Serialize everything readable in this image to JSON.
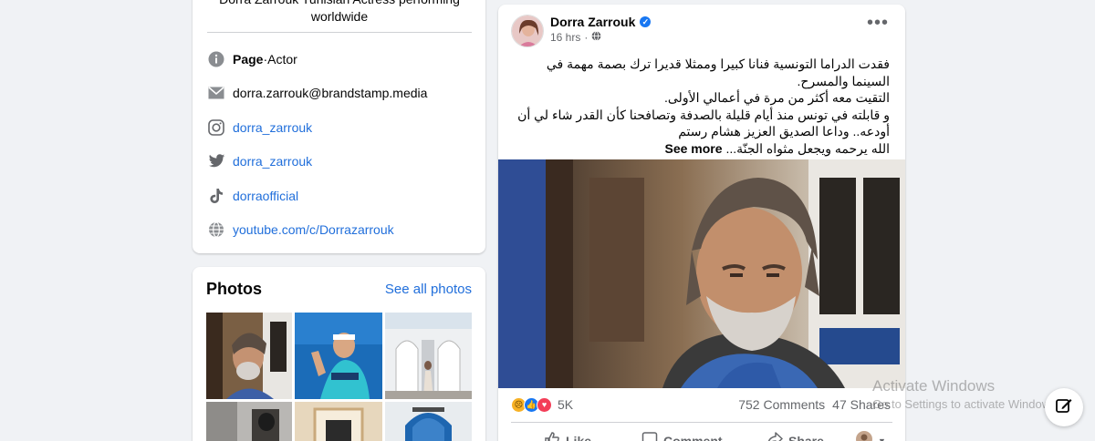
{
  "intro": {
    "bio": "Dorra Zarrouk Tunisian Actress performing worldwide",
    "page_label": "Page",
    "page_sep": " · ",
    "page_category": "Actor",
    "email": "dorra.zarrouk@brandstamp.media",
    "instagram": "dorra_zarrouk",
    "twitter": "dorra_zarrouk",
    "tiktok": "dorraofficial",
    "youtube": "youtube.com/c/Dorrazarrouk"
  },
  "photos": {
    "title": "Photos",
    "see_all": "See all photos"
  },
  "post": {
    "author": "Dorra Zarrouk",
    "time": "16 hrs",
    "separator": "·",
    "text_lines": [
      "فقدت الدراما التونسية فنانا كبيرا وممثلا قديرا ترك بصمة مهمة في السينما والمسرح.",
      "التقيت معه أكثر من مرة في أعمالي الأولى.",
      "و قابلته في تونس منذ أيام قليلة بالصدفة وتصافحنا كأن القدر شاء لي أن أودعه.. وداعا الصديق العزيز هشام رستم",
      "الله يرحمه ويجعل مثواه الجنّة..."
    ],
    "see_more": "See more",
    "reaction_count": "5K",
    "comments": "752 Comments",
    "shares": "47 Shares",
    "actions": {
      "like": "Like",
      "comment": "Comment",
      "share": "Share"
    }
  },
  "watermark": {
    "line1": "Activate Windows",
    "line2": "Go to Settings to activate Windows."
  },
  "colors": {
    "link": "#216fdb",
    "verified": "#1877f2",
    "background": "#f0f2f5"
  }
}
